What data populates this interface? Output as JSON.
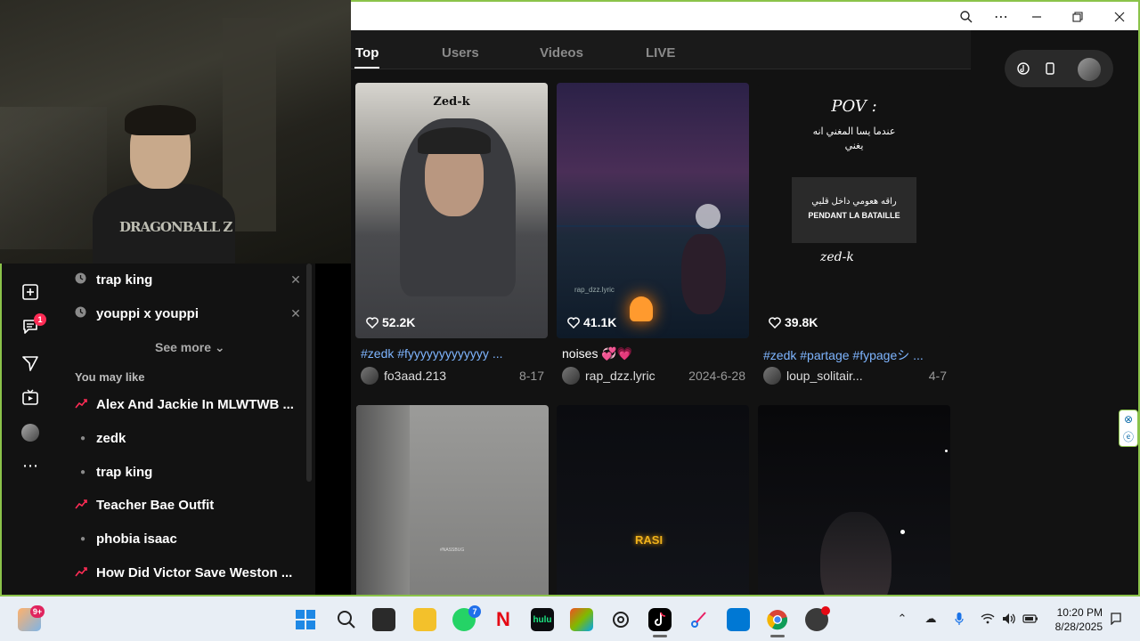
{
  "window": {
    "zoom_icon": "zoom-icon",
    "more_icon": "more-icon",
    "minimize_icon": "minimize-icon",
    "restore_icon": "restore-icon",
    "close_icon": "close-icon"
  },
  "webcam": {
    "shirt_text": "DRAGONBALL Z"
  },
  "leftbar": {
    "message_badge": "1"
  },
  "history": {
    "recent": [
      {
        "label": "trap king"
      },
      {
        "label": "youppi x youppi"
      }
    ],
    "see_more": "See more ⌄",
    "you_may_like": "You may like",
    "suggestions": [
      {
        "label": "Alex And Jackie In MLWTWB ...",
        "kind": "trend"
      },
      {
        "label": "zedk",
        "kind": "dot"
      },
      {
        "label": "trap king",
        "kind": "dot"
      },
      {
        "label": "Teacher Bae Outfit",
        "kind": "trend"
      },
      {
        "label": "phobia isaac",
        "kind": "dot"
      },
      {
        "label": "How Did Victor Save Weston ...",
        "kind": "trend"
      }
    ]
  },
  "tabs": [
    {
      "label": "Top",
      "active": true
    },
    {
      "label": "Users",
      "active": false
    },
    {
      "label": "Videos",
      "active": false
    },
    {
      "label": "LIVE",
      "active": false
    }
  ],
  "videos": [
    {
      "overlay": "Zed-k",
      "likes": "52.2K",
      "caption": "#zedk #fyyyyyyyyyyyyy ...",
      "caption_is_tag": true,
      "user": "fo3aad.213",
      "date": "8-17"
    },
    {
      "overlay": "rap_dzz.lyric",
      "likes": "41.1K",
      "caption": "noises 💞💗",
      "caption_is_tag": false,
      "user": "rap_dzz.lyric",
      "date": "2024-6-28"
    },
    {
      "overlay_title": "POV :",
      "overlay_arabic_1": "عندما يسا المغني انه",
      "overlay_arabic_2": "يغني",
      "overlay_box_arabic": "راقه هعومي داخل قلبي",
      "overlay_box_latin": "PENDANT LA BATAILLE",
      "overlay_sign": "zed-k",
      "likes": "39.8K",
      "caption": "#zedk #partage #fypageシ ...",
      "caption_is_tag": true,
      "user": "loup_solitair...",
      "date": "4-7"
    },
    {
      "overlay": "#NASSBUG"
    },
    {
      "overlay": "RASI"
    },
    {
      "overlay": ""
    }
  ],
  "taskbar": {
    "weather_badge": "9+",
    "whatsapp_badge": "7",
    "hulu_label": "hulu",
    "netflix_label": "N",
    "time": "10:20 PM",
    "date": "8/28/2025"
  },
  "colors": {
    "accent_pink": "#fe2c55",
    "frame_green": "#8bc34a",
    "tag_blue": "#7eb5ff"
  }
}
